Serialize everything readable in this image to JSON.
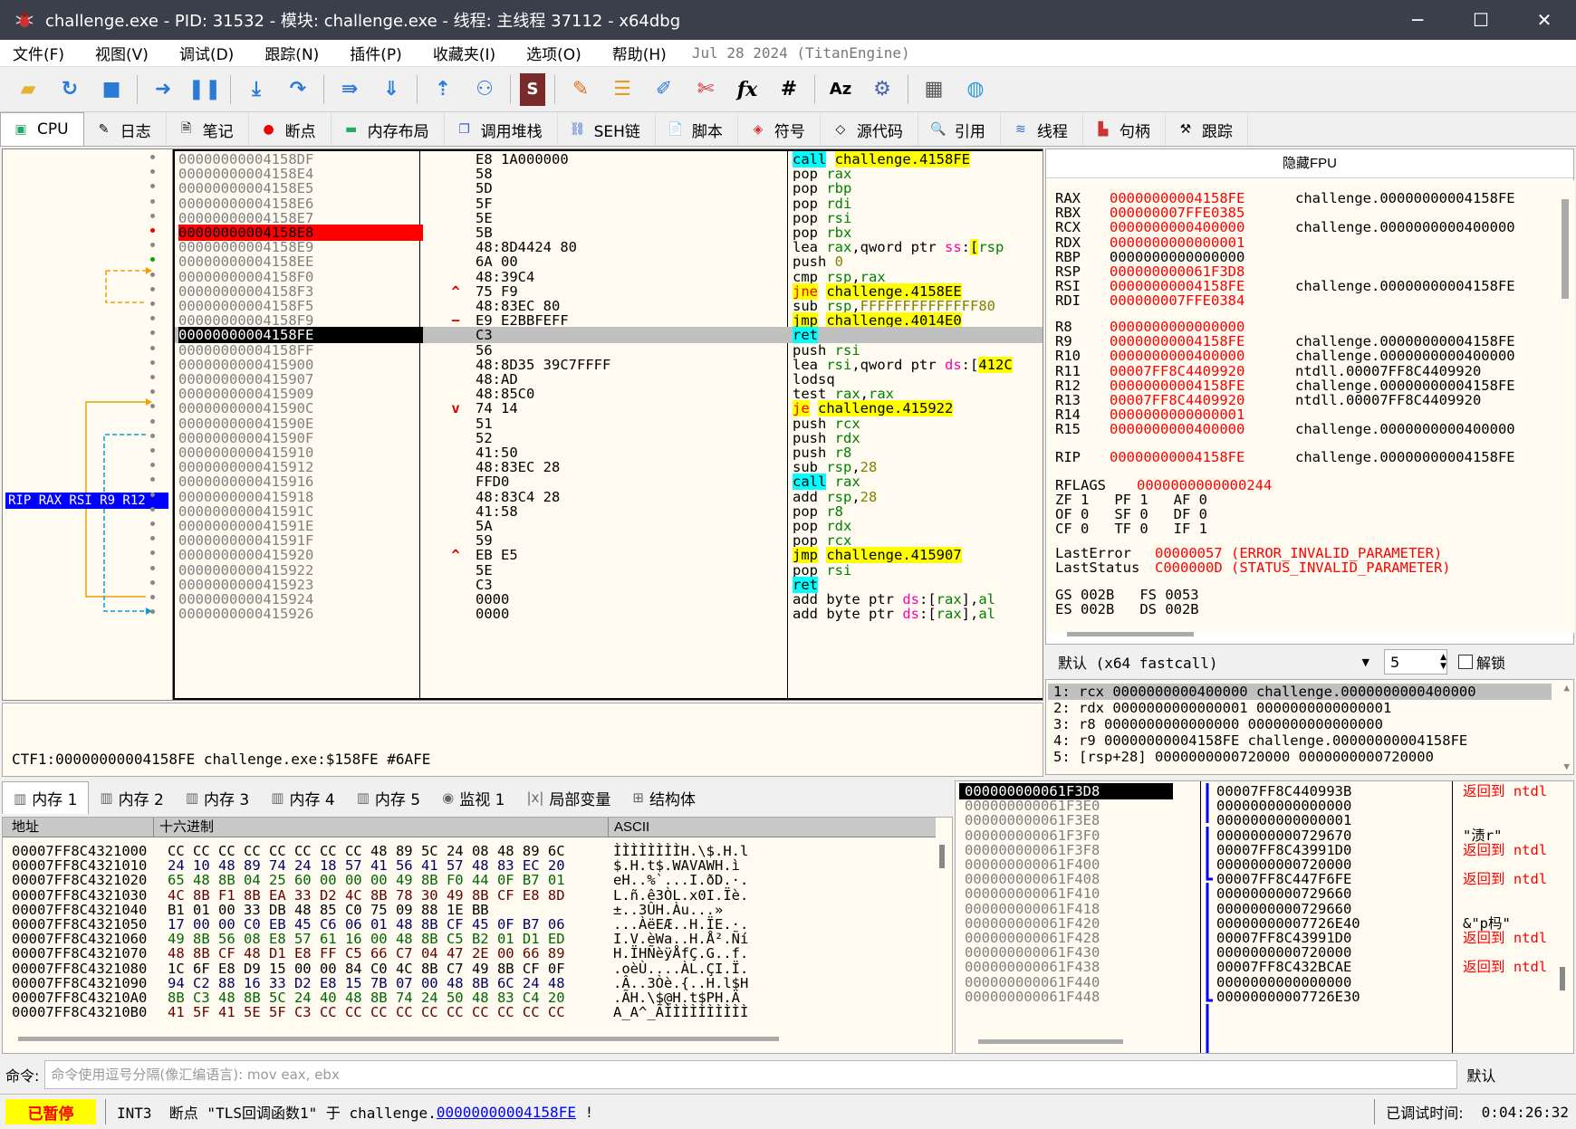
{
  "window": {
    "title": "challenge.exe - PID: 31532 - 模块: challenge.exe - 线程: 主线程 37112 - x64dbg",
    "min": "─",
    "max": "☐",
    "close": "✕"
  },
  "menu": {
    "items": [
      "文件(F)",
      "视图(V)",
      "调试(D)",
      "跟踪(N)",
      "插件(P)",
      "收藏夹(I)",
      "选项(O)",
      "帮助(H)"
    ],
    "build_info": "Jul 28 2024 (TitanEngine)"
  },
  "toolbar": {
    "icons": [
      "open-icon",
      "restart-icon",
      "stop-icon",
      "run-icon",
      "pause-icon",
      "step-into-icon",
      "step-over-icon",
      "trace-into-icon",
      "trace-over-icon",
      "execute-till-return-icon",
      "run-to-user-code-icon",
      "scylla-icon",
      "patch-icon",
      "comments-icon",
      "labels-icon",
      "bookmarks-icon",
      "functions-icon",
      "variables-icon",
      "strings-icon",
      "calculator-icon",
      "settings-icon",
      "globe-icon"
    ]
  },
  "tabs": [
    {
      "label": "CPU",
      "icon": "cpu-icon"
    },
    {
      "label": "日志",
      "icon": "log-icon"
    },
    {
      "label": "笔记",
      "icon": "notes-icon"
    },
    {
      "label": "断点",
      "icon": "breakpoint-icon"
    },
    {
      "label": "内存布局",
      "icon": "memory-map-icon"
    },
    {
      "label": "调用堆栈",
      "icon": "call-stack-icon"
    },
    {
      "label": "SEH链",
      "icon": "seh-icon"
    },
    {
      "label": "脚本",
      "icon": "script-icon"
    },
    {
      "label": "符号",
      "icon": "symbols-icon"
    },
    {
      "label": "源代码",
      "icon": "source-icon"
    },
    {
      "label": "引用",
      "icon": "references-icon"
    },
    {
      "label": "线程",
      "icon": "threads-icon"
    },
    {
      "label": "句柄",
      "icon": "handles-icon"
    },
    {
      "label": "跟踪",
      "icon": "trace-icon"
    }
  ],
  "disasm": {
    "rip_label": "RIP RAX RSI R9 R12",
    "rows": [
      {
        "addr": "00000000004158DF",
        "arrow": "",
        "bytes": "E8 1A000000",
        "ins": [
          [
            "call",
            "call"
          ],
          [
            "t",
            " "
          ],
          [
            "lbl",
            "challenge.4158FE"
          ]
        ]
      },
      {
        "addr": "00000000004158E4",
        "arrow": "",
        "bytes": "58",
        "ins": [
          [
            "mn",
            "pop "
          ],
          [
            "reg",
            "rax"
          ]
        ]
      },
      {
        "addr": "00000000004158E5",
        "arrow": "",
        "bytes": "5D",
        "ins": [
          [
            "mn",
            "pop "
          ],
          [
            "reg",
            "rbp"
          ]
        ]
      },
      {
        "addr": "00000000004158E6",
        "arrow": "",
        "bytes": "5F",
        "ins": [
          [
            "mn",
            "pop "
          ],
          [
            "reg",
            "rdi"
          ]
        ]
      },
      {
        "addr": "00000000004158E7",
        "arrow": "",
        "bytes": "5E",
        "ins": [
          [
            "mn",
            "pop "
          ],
          [
            "reg",
            "rsi"
          ]
        ]
      },
      {
        "addr": "00000000004158E8",
        "arrow": "",
        "bytes": "5B",
        "ins": [
          [
            "mn",
            "pop "
          ],
          [
            "reg",
            "rbx"
          ]
        ],
        "bp": true
      },
      {
        "addr": "00000000004158E9",
        "arrow": "",
        "bytes": "48:8D4424 80",
        "ins": [
          [
            "mn",
            "lea "
          ],
          [
            "reg",
            "rax"
          ],
          [
            "mn",
            ",qword ptr "
          ],
          [
            "seg",
            "ss"
          ],
          [
            "mn",
            ":"
          ],
          [
            "lbl",
            "["
          ],
          [
            "reg",
            "rsp"
          ]
        ]
      },
      {
        "addr": "00000000004158EE",
        "arrow": "",
        "bytes": "6A 00",
        "ins": [
          [
            "mn",
            "push "
          ],
          [
            "num",
            "0"
          ]
        ]
      },
      {
        "addr": "00000000004158F0",
        "arrow": "",
        "bytes": "48:39C4",
        "ins": [
          [
            "mn",
            "cmp "
          ],
          [
            "reg",
            "rsp"
          ],
          [
            "mn",
            ","
          ],
          [
            "reg",
            "rax"
          ]
        ]
      },
      {
        "addr": "00000000004158F3",
        "arrow": "^",
        "bytes": "75 F9",
        "ins": [
          [
            "jcc",
            "jne"
          ],
          [
            "t",
            " "
          ],
          [
            "lbl",
            "challenge.4158EE"
          ]
        ]
      },
      {
        "addr": "00000000004158F5",
        "arrow": "",
        "bytes": "48:83EC 80",
        "ins": [
          [
            "mn",
            "sub "
          ],
          [
            "reg",
            "rsp"
          ],
          [
            "mn",
            ","
          ],
          [
            "num",
            "FFFFFFFFFFFFFF80"
          ]
        ]
      },
      {
        "addr": "00000000004158F9",
        "arrow": "−",
        "bytes": "E9 E2BBFEFF",
        "ins": [
          [
            "jmp",
            "jmp"
          ],
          [
            "t",
            " "
          ],
          [
            "lbl",
            "challenge.4014E0"
          ]
        ]
      },
      {
        "addr": "00000000004158FE",
        "arrow": "",
        "bytes": "C3",
        "ins": [
          [
            "ret",
            "ret"
          ]
        ],
        "cur": true
      },
      {
        "addr": "00000000004158FF",
        "arrow": "",
        "bytes": "56",
        "ins": [
          [
            "mn",
            "push "
          ],
          [
            "reg",
            "rsi"
          ]
        ]
      },
      {
        "addr": "0000000000415900",
        "arrow": "",
        "bytes": "48:8D35 39C7FFFF",
        "ins": [
          [
            "mn",
            "lea "
          ],
          [
            "reg",
            "rsi"
          ],
          [
            "mn",
            ",qword ptr "
          ],
          [
            "seg",
            "ds"
          ],
          [
            "mn",
            ":["
          ],
          [
            "lbl",
            "412C"
          ]
        ]
      },
      {
        "addr": "0000000000415907",
        "arrow": "",
        "bytes": "48:AD",
        "ins": [
          [
            "mn",
            "lodsq"
          ]
        ]
      },
      {
        "addr": "0000000000415909",
        "arrow": "",
        "bytes": "48:85C0",
        "ins": [
          [
            "mn",
            "test "
          ],
          [
            "reg",
            "rax"
          ],
          [
            "mn",
            ","
          ],
          [
            "reg",
            "rax"
          ]
        ]
      },
      {
        "addr": "000000000041590C",
        "arrow": "v",
        "bytes": "74 14",
        "ins": [
          [
            "jcc",
            "je"
          ],
          [
            "t",
            " "
          ],
          [
            "lbl",
            "challenge.415922"
          ]
        ]
      },
      {
        "addr": "000000000041590E",
        "arrow": "",
        "bytes": "51",
        "ins": [
          [
            "mn",
            "push "
          ],
          [
            "reg",
            "rcx"
          ]
        ]
      },
      {
        "addr": "000000000041590F",
        "arrow": "",
        "bytes": "52",
        "ins": [
          [
            "mn",
            "push "
          ],
          [
            "reg",
            "rdx"
          ]
        ]
      },
      {
        "addr": "0000000000415910",
        "arrow": "",
        "bytes": "41:50",
        "ins": [
          [
            "mn",
            "push "
          ],
          [
            "reg",
            "r8"
          ]
        ]
      },
      {
        "addr": "0000000000415912",
        "arrow": "",
        "bytes": "48:83EC 28",
        "ins": [
          [
            "mn",
            "sub "
          ],
          [
            "reg",
            "rsp"
          ],
          [
            "mn",
            ","
          ],
          [
            "num",
            "28"
          ]
        ]
      },
      {
        "addr": "0000000000415916",
        "arrow": "",
        "bytes": "FFD0",
        "ins": [
          [
            "call",
            "call"
          ],
          [
            "t",
            " "
          ],
          [
            "reg",
            "rax"
          ]
        ]
      },
      {
        "addr": "0000000000415918",
        "arrow": "",
        "bytes": "48:83C4 28",
        "ins": [
          [
            "mn",
            "add "
          ],
          [
            "reg",
            "rsp"
          ],
          [
            "mn",
            ","
          ],
          [
            "num",
            "28"
          ]
        ]
      },
      {
        "addr": "000000000041591C",
        "arrow": "",
        "bytes": "41:58",
        "ins": [
          [
            "mn",
            "pop "
          ],
          [
            "reg",
            "r8"
          ]
        ]
      },
      {
        "addr": "000000000041591E",
        "arrow": "",
        "bytes": "5A",
        "ins": [
          [
            "mn",
            "pop "
          ],
          [
            "reg",
            "rdx"
          ]
        ]
      },
      {
        "addr": "000000000041591F",
        "arrow": "",
        "bytes": "59",
        "ins": [
          [
            "mn",
            "pop "
          ],
          [
            "reg",
            "rcx"
          ]
        ]
      },
      {
        "addr": "0000000000415920",
        "arrow": "^",
        "bytes": "EB E5",
        "ins": [
          [
            "jmp",
            "jmp"
          ],
          [
            "t",
            " "
          ],
          [
            "lbl",
            "challenge.415907"
          ]
        ]
      },
      {
        "addr": "0000000000415922",
        "arrow": "",
        "bytes": "5E",
        "ins": [
          [
            "mn",
            "pop "
          ],
          [
            "reg",
            "rsi"
          ]
        ]
      },
      {
        "addr": "0000000000415923",
        "arrow": "",
        "bytes": "C3",
        "ins": [
          [
            "ret",
            "ret"
          ]
        ]
      },
      {
        "addr": "0000000000415924",
        "arrow": "",
        "bytes": "0000",
        "ins": [
          [
            "mn",
            "add byte ptr "
          ],
          [
            "seg",
            "ds"
          ],
          [
            "mn",
            ":["
          ],
          [
            "reg",
            "rax"
          ],
          [
            "mn",
            "],"
          ],
          [
            "reg",
            "al"
          ]
        ]
      },
      {
        "addr": "0000000000415926",
        "arrow": "",
        "bytes": "0000",
        "ins": [
          [
            "mn",
            "add byte ptr "
          ],
          [
            "seg",
            "ds"
          ],
          [
            "mn",
            ":["
          ],
          [
            "reg",
            "rax"
          ],
          [
            "mn",
            "],"
          ],
          [
            "reg",
            "al"
          ]
        ]
      }
    ]
  },
  "infobox": {
    "text": "CTF1:00000000004158FE challenge.exe:$158FE #6AFE"
  },
  "registers": {
    "header": "隐藏FPU",
    "gp": [
      {
        "n": "RAX",
        "v": "00000000004158FE",
        "c": "challenge.00000000004158FE",
        "chg": true
      },
      {
        "n": "RBX",
        "v": "000000007FFE0385",
        "c": "",
        "chg": true
      },
      {
        "n": "RCX",
        "v": "0000000000400000",
        "c": "challenge.0000000000400000",
        "chg": true
      },
      {
        "n": "RDX",
        "v": "0000000000000001",
        "c": "",
        "chg": true
      },
      {
        "n": "RBP",
        "v": "0000000000000000",
        "c": "",
        "chg": false
      },
      {
        "n": "RSP",
        "v": "000000000061F3D8",
        "c": "",
        "chg": true
      },
      {
        "n": "RSI",
        "v": "00000000004158FE",
        "c": "challenge.00000000004158FE",
        "chg": true
      },
      {
        "n": "RDI",
        "v": "000000007FFE0384",
        "c": "",
        "chg": true
      }
    ],
    "ext": [
      {
        "n": "R8",
        "v": "0000000000000000",
        "c": "",
        "chg": true
      },
      {
        "n": "R9",
        "v": "00000000004158FE",
        "c": "challenge.00000000004158FE",
        "chg": true
      },
      {
        "n": "R10",
        "v": "0000000000400000",
        "c": "challenge.0000000000400000",
        "chg": true
      },
      {
        "n": "R11",
        "v": "00007FF8C4409920",
        "c": "ntdll.00007FF8C4409920",
        "chg": true
      },
      {
        "n": "R12",
        "v": "00000000004158FE",
        "c": "challenge.00000000004158FE",
        "chg": true
      },
      {
        "n": "R13",
        "v": "00007FF8C4409920",
        "c": "ntdll.00007FF8C4409920",
        "chg": true
      },
      {
        "n": "R14",
        "v": "0000000000000001",
        "c": "",
        "chg": true
      },
      {
        "n": "R15",
        "v": "0000000000400000",
        "c": "challenge.0000000000400000",
        "chg": true
      }
    ],
    "rip": {
      "n": "RIP",
      "v": "00000000004158FE",
      "c": "challenge.00000000004158FE"
    },
    "rflags": {
      "n": "RFLAGS",
      "v": "0000000000000244"
    },
    "flags": [
      "ZF 1   PF 1   AF 0",
      "OF 0   SF 0   DF 0",
      "CF 0   TF 0   IF 1"
    ],
    "lasterror": {
      "n": "LastError",
      "v": "00000057 (ERROR_INVALID_PARAMETER)"
    },
    "laststatus": {
      "n": "LastStatus",
      "v": "C000000D (STATUS_INVALID_PARAMETER)"
    },
    "segs": [
      "GS 002B   FS 0053",
      "ES 002B   DS 002B"
    ]
  },
  "callconv": {
    "selected": "默认 (x64 fastcall)",
    "count": "5",
    "unlock": "解锁"
  },
  "args": [
    "1: rcx 0000000000400000 challenge.0000000000400000",
    "2: rdx 0000000000000001 0000000000000001",
    "3: r8 0000000000000000 0000000000000000",
    "4: r9 00000000004158FE challenge.00000000004158FE",
    "5: [rsp+28] 0000000000720000 0000000000720000"
  ],
  "dumptabs": [
    {
      "label": "内存 1",
      "icon": "dump-icon"
    },
    {
      "label": "内存 2",
      "icon": "dump-icon"
    },
    {
      "label": "内存 3",
      "icon": "dump-icon"
    },
    {
      "label": "内存 4",
      "icon": "dump-icon"
    },
    {
      "label": "内存 5",
      "icon": "dump-icon"
    },
    {
      "label": "监视 1",
      "icon": "watch-icon"
    },
    {
      "label": "局部变量",
      "icon": "locals-icon"
    },
    {
      "label": "结构体",
      "icon": "struct-icon"
    }
  ],
  "dump": {
    "headers": {
      "addr": "地址",
      "hex": "十六进制",
      "ascii": "ASCII"
    },
    "rows": [
      {
        "a": "00007FF8C4321000",
        "h": "CC CC CC CC CC CC CC CC 48 89 5C 24 08 48 89 6C",
        "s": "ÌÌÌÌÌÌÌÌH.\\$.H.l"
      },
      {
        "a": "00007FF8C4321010",
        "h": "24 10 48 89 74 24 18 57 41 56 41 57 48 83 EC 20",
        "s": "$.H.t$.WAVAWH.ì "
      },
      {
        "a": "00007FF8C4321020",
        "h": "65 48 8B 04 25 60 00 00 00 49 8B F0 44 0F B7 01",
        "s": "eH..%`...I.ðD.·."
      },
      {
        "a": "00007FF8C4321030",
        "h": "4C 8B F1 8B EA 33 D2 4C 8B 78 30 49 8B CF E8 8D",
        "s": "L.ñ.ê3ÒL.x0I.Ïè."
      },
      {
        "a": "00007FF8C4321040",
        "h": "B1 01 00 33 DB 48 85 C0 75 09 88 1E BB",
        "s": "±..3ÛH.Àu...»"
      },
      {
        "a": "00007FF8C4321050",
        "h": "17 00 00 C0 EB 45 C6 06 01 48 8B CF 45 0F B7 06",
        "s": "...ÀëEÆ..H.ÏE.·."
      },
      {
        "a": "00007FF8C4321060",
        "h": "49 8B 56 08 E8 57 61 16 00 48 8B C5 B2 01 D1 ED",
        "s": "I.V.èWa..H.Å².Ñí"
      },
      {
        "a": "00007FF8C4321070",
        "h": "48 8B CF 48 D1 E8 FF C5 66 C7 04 47 2E 00 66 89",
        "s": "H.ÏHÑèÿÅfÇ.G..f."
      },
      {
        "a": "00007FF8C4321080",
        "h": "1C 6F E8 D9 15 00 00 84 C0 4C 8B C7 49 8B CF 0F",
        "s": ".oèÙ....ÀL.ÇI.Ï."
      },
      {
        "a": "00007FF8C4321090",
        "h": "94 C2 88 16 33 D2 E8 15 7B 07 00 48 8B 6C 24 48",
        "s": ".Â..3Òè.{..H.l$H"
      },
      {
        "a": "00007FF8C43210A0",
        "h": "8B C3 48 8B 5C 24 40 48 8B 74 24 50 48 83 C4 20",
        "s": ".ÃH.\\$@H.t$PH.Ä "
      },
      {
        "a": "00007FF8C43210B0",
        "h": "41 5F 41 5E 5F C3 CC CC CC CC CC CC CC CC CC CC",
        "s": "A_A^_ÃÌÌÌÌÌÌÌÌÌÌ"
      }
    ]
  },
  "stack": {
    "rows": [
      {
        "a": "000000000061F3D8",
        "v": "00007FF8C440993B",
        "c": "返回到 ntdl"
      },
      {
        "a": "000000000061F3E0",
        "v": "0000000000000000",
        "c": ""
      },
      {
        "a": "000000000061F3E8",
        "v": "0000000000000001",
        "c": ""
      },
      {
        "a": "000000000061F3F0",
        "v": "0000000000729670",
        "c": "\"渍r\""
      },
      {
        "a": "000000000061F3F8",
        "v": "00007FF8C43991D0",
        "c": "返回到 ntdl"
      },
      {
        "a": "000000000061F400",
        "v": "0000000000720000",
        "c": ""
      },
      {
        "a": "000000000061F408",
        "v": "00007FF8C447F6FE",
        "c": "返回到 ntdl"
      },
      {
        "a": "000000000061F410",
        "v": "0000000000729660",
        "c": ""
      },
      {
        "a": "000000000061F418",
        "v": "0000000000729660",
        "c": ""
      },
      {
        "a": "000000000061F420",
        "v": "00000000007726E40",
        "c": "&\"p杩\""
      },
      {
        "a": "000000000061F428",
        "v": "00007FF8C43991D0",
        "c": "返回到 ntdl"
      },
      {
        "a": "000000000061F430",
        "v": "0000000000720000",
        "c": ""
      },
      {
        "a": "000000000061F438",
        "v": "00007FF8C432BCAE",
        "c": "返回到 ntdl"
      },
      {
        "a": "000000000061F440",
        "v": "0000000000000000",
        "c": ""
      },
      {
        "a": "000000000061F448",
        "v": "00000000007726E30",
        "c": ""
      }
    ]
  },
  "command": {
    "label": "命令:",
    "placeholder": "命令使用逗号分隔(像汇编语言): mov eax, ebx",
    "mode": "默认"
  },
  "status": {
    "state": "已暂停",
    "msg_prefix": "INT3  断点 \"TLS回调函数1\" 于 challenge.",
    "msg_link": "00000000004158FE",
    "msg_suffix": " !",
    "elapsed_label": "已调试时间:",
    "elapsed": "0:04:26:32"
  }
}
